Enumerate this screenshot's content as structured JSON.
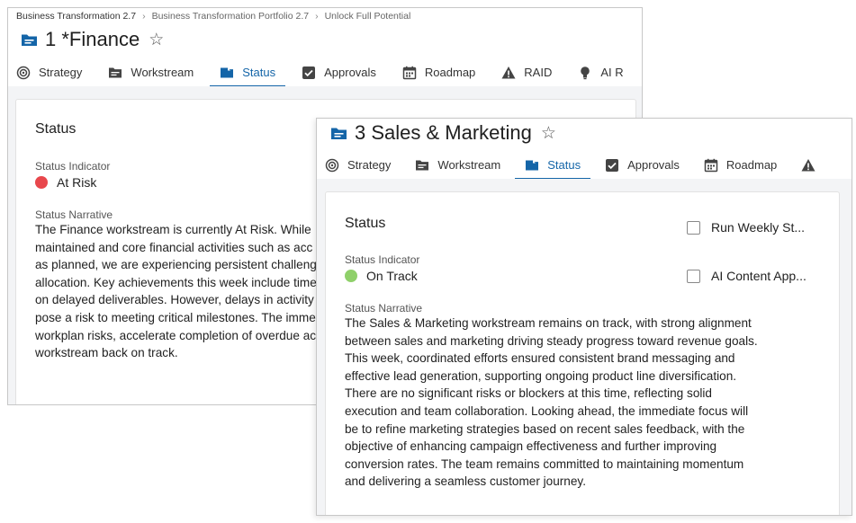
{
  "win1": {
    "breadcrumb": [
      "Business Transformation 2.7",
      "Business Transformation Portfolio 2.7",
      "Unlock Full Potential"
    ],
    "title": "1 *Finance",
    "tabs": [
      {
        "label": "Strategy",
        "icon": "target-icon"
      },
      {
        "label": "Workstream",
        "icon": "folder-list-icon"
      },
      {
        "label": "Status",
        "icon": "folder-icon",
        "active": true
      },
      {
        "label": "Approvals",
        "icon": "checkbox-icon"
      },
      {
        "label": "Roadmap",
        "icon": "calendar-icon"
      },
      {
        "label": "RAID",
        "icon": "warning-icon"
      },
      {
        "label": "AI R",
        "icon": "lightbulb-icon"
      }
    ],
    "status": {
      "heading": "Status",
      "indicator_label": "Status Indicator",
      "indicator_value": "At Risk",
      "indicator_color": "#e8474c",
      "narrative_label": "Status Narrative",
      "narrative_lines": [
        "The Finance workstream is currently At Risk. While",
        "maintained and core financial activities such as acc",
        "as planned, we are experiencing persistent challeng",
        "allocation. Key achievements this week include time",
        "on delayed deliverables. However, delays in activity",
        "pose a risk to meeting critical milestones. The imme",
        "workplan risks, accelerate completion of overdue ac",
        "workstream back on track."
      ]
    }
  },
  "win2": {
    "title": "3 Sales & Marketing",
    "tabs": [
      {
        "label": "Strategy",
        "icon": "target-icon"
      },
      {
        "label": "Workstream",
        "icon": "folder-list-icon"
      },
      {
        "label": "Status",
        "icon": "folder-icon",
        "active": true
      },
      {
        "label": "Approvals",
        "icon": "checkbox-icon"
      },
      {
        "label": "Roadmap",
        "icon": "calendar-icon"
      },
      {
        "label": "",
        "icon": "warning-icon"
      }
    ],
    "status": {
      "heading": "Status",
      "indicator_label": "Status Indicator",
      "indicator_value": "On Track",
      "indicator_color": "#8fd06a",
      "narrative_label": "Status Narrative",
      "narrative_lines": [
        "The Sales & Marketing workstream remains on track, with strong alignment",
        "between sales and marketing driving steady progress toward revenue goals.",
        "This week, coordinated efforts ensured consistent brand messaging and",
        "effective lead generation, supporting ongoing product line diversification.",
        "There are no significant risks or blockers at this time, reflecting solid",
        "execution and team collaboration. Looking ahead, the immediate focus will",
        "be to refine marketing strategies based on recent sales feedback, with the",
        "objective of enhancing campaign effectiveness and further improving",
        "conversion rates. The team remains committed to maintaining momentum",
        "and delivering a seamless customer journey."
      ]
    },
    "checkboxes": [
      {
        "label": "Run Weekly St...",
        "checked": false
      },
      {
        "label": "AI Content App...",
        "checked": false
      }
    ]
  },
  "colors": {
    "accent": "#1465a8",
    "at_risk": "#e8474c",
    "on_track": "#8fd06a"
  }
}
